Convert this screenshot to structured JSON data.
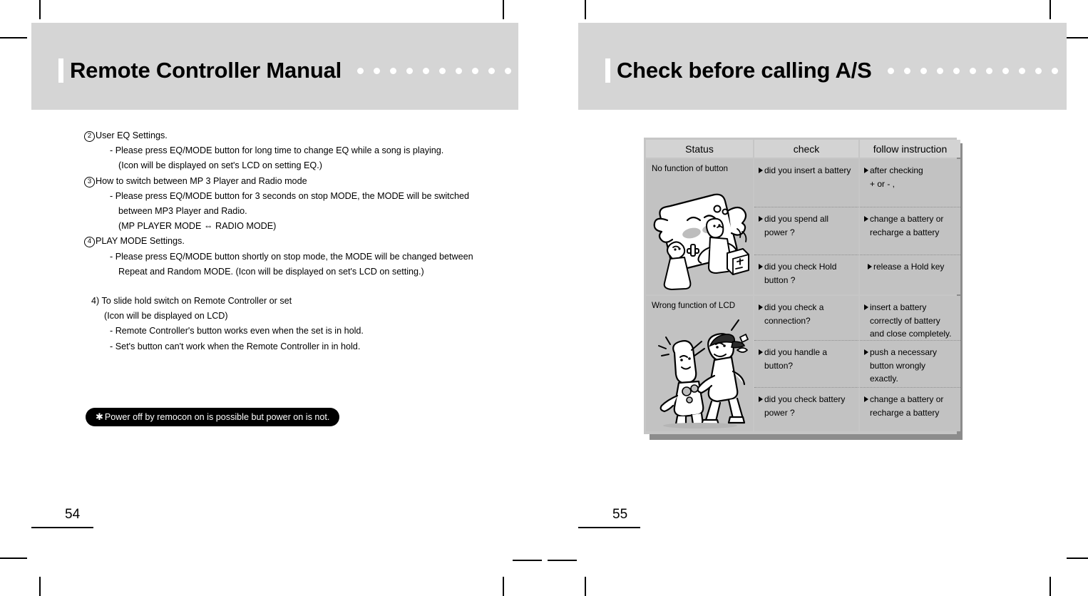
{
  "spread": {
    "left_page": {
      "header_title": "Remote Controller Manual",
      "page_number": "54",
      "lines": [
        {
          "indent": "ind3",
          "circle": "2",
          "text": "User EQ Settings."
        },
        {
          "indent": "ind1",
          "circle": "",
          "text": "- Please press EQ/MODE button for long time to change EQ while a song is playing."
        },
        {
          "indent": "ind2",
          "circle": "",
          "text": "(Icon will be displayed on set's LCD on setting EQ.)"
        },
        {
          "indent": "ind3",
          "circle": "3",
          "text": "How to switch  between  MP 3 Player and Radio mode"
        },
        {
          "indent": "ind1",
          "circle": "",
          "text": "- Please press EQ/MODE button for 3 seconds on stop MODE, the MODE will be switched"
        },
        {
          "indent": "ind2",
          "circle": "",
          "text": "between MP3 Player and Radio."
        },
        {
          "indent": "ind2",
          "circle": "",
          "text": "(MP PLAYER MODE ⇔ RADIO MODE)"
        },
        {
          "indent": "ind3",
          "circle": "4",
          "text": "PLAY MODE Settings."
        },
        {
          "indent": "ind1",
          "circle": "",
          "text": "- Please press EQ/MODE button shortly on stop mode, the MODE will be changed between"
        },
        {
          "indent": "ind2",
          "circle": "",
          "text": "Repeat and Random MODE. (Icon will be displayed on set's LCD on setting.)"
        },
        {
          "indent": "gap",
          "circle": "",
          "text": ""
        },
        {
          "indent": "ind4",
          "circle": "",
          "text": "4) To slide hold switch on Remote Controller or set"
        },
        {
          "indent": "ind5",
          "circle": "",
          "text": "(Icon will be displayed on LCD)"
        },
        {
          "indent": "ind1",
          "circle": "",
          "text": "- Remote Controller's button works even when the set is in hold."
        },
        {
          "indent": "ind1",
          "circle": "",
          "text": "- Set's button can't work when the Remote Controller in in hold."
        }
      ],
      "note": {
        "star": "✱",
        "text": "Power off by remocon on is possible but power on is not."
      }
    },
    "right_page": {
      "header_title": "Check before calling A/S",
      "page_number": "55",
      "table": {
        "columns": [
          "Status",
          "check",
          "follow instruction"
        ],
        "groups": [
          {
            "status": "No function of button",
            "illustration": "remote-controller-characters-illustration",
            "checks": [
              "did you insert a battery",
              "did you spend all power ?",
              "did you check Hold button ?"
            ],
            "instructions": [
              "after checking\n+ or - ,",
              "change a battery or recharge a battery",
              " release a Hold key"
            ]
          },
          {
            "status": "Wrong function of LCD",
            "illustration": "angry-characters-illustration",
            "checks": [
              "did you check a connection?",
              "did you handle a button?",
              "did you check battery power ?"
            ],
            "instructions": [
              "insert a battery correctly of battery and close completely.",
              "push a necessary button wrongly exactly.",
              "change a battery or recharge a battery"
            ]
          }
        ]
      }
    }
  },
  "colors": {
    "header_band": "#d5d5d5",
    "table_header_cell": "#d3d3d3",
    "table_cell": "#c2c2c2",
    "table_frame": "#c6c6c6",
    "table_shadow": "#8c8c8c",
    "note_pill_bg": "#000000"
  }
}
